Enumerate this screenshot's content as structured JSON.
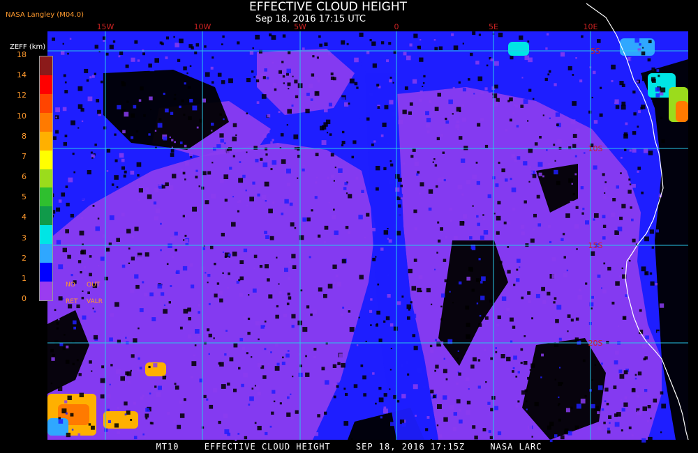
{
  "header": {
    "source": "NASA Langley (M04.0)",
    "title": "EFFECTIVE CLOUD HEIGHT",
    "subtitle": "Sep 18, 2016 17:15 UTC"
  },
  "footer": {
    "product": "MT10",
    "name": "EFFECTIVE CLOUD HEIGHT",
    "time": "SEP 18, 2016 17:15Z",
    "agency": "NASA LARC"
  },
  "legend": {
    "title": "ZEFF (km)",
    "ticks": [
      "18",
      "14",
      "12",
      "10",
      "8",
      "7",
      "6",
      "5",
      "4",
      "3",
      "2",
      "1",
      "0"
    ],
    "no_label": "NO",
    "out_label": "OUT",
    "ret_label": "RET",
    "valr_label": "VALR",
    "colors": [
      "#8b1a1a",
      "#ff0000",
      "#ff4400",
      "#ff7a00",
      "#ffb000",
      "#ffff00",
      "#9bdc1c",
      "#2fbf2f",
      "#109a4a",
      "#00e5e5",
      "#2fa7ff",
      "#0000ff",
      "#9a3cf0"
    ]
  },
  "map": {
    "lon_labels": [
      "15W",
      "10W",
      "5W",
      "0",
      "5E",
      "10E"
    ],
    "lat_labels": [
      "5S",
      "10S",
      "15S",
      "20S"
    ],
    "colors": {
      "low_purple": "#8a3cf0",
      "mid_blue": "#1e1eff",
      "clear": "#000000",
      "coast": "#ffffff",
      "grid": "#28c8e8"
    }
  }
}
